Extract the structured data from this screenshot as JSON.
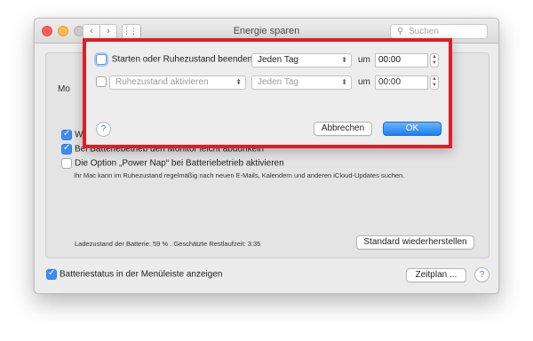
{
  "window": {
    "title": "Energie sparen",
    "search_placeholder": "Suchen",
    "nav_back": "‹",
    "nav_forward": "›",
    "grid": "⋮⋮⋮"
  },
  "main": {
    "partial_label": "Mo",
    "checkbox1_label": "We",
    "checkbox2_label": "Bei Batteriebetrieb den Monitor leicht abdunkeln",
    "checkbox3_label": "Die Option „Power Nap“ bei Batteriebetrieb aktivieren",
    "power_nap_description": "Ihr Mac kann im Ruhezustand regelmäßig nach neuen E-Mails, Kalendern und anderen iCloud-Updates suchen.",
    "battery_status": "Ladezustand der Batterie: 59 % . Geschätzte Restlaufzeit: 3:35",
    "restore_defaults_label": "Standard wiederherstellen",
    "menubar_battery_label": "Batteriestatus in der Menüleiste anzeigen",
    "schedule_label": "Zeitplan ...",
    "help_label": "?",
    "checkbox_states": {
      "checkbox1": true,
      "checkbox2": true,
      "checkbox3": false,
      "menubar_battery": true
    }
  },
  "sheet": {
    "row1": {
      "label": "Starten oder Ruhezustand beenden",
      "checked": false,
      "day": "Jeden Tag",
      "at_label": "um",
      "time": "00:00"
    },
    "row2": {
      "action": "Ruhezustand aktivieren",
      "checked": false,
      "day": "Jeden Tag",
      "at_label": "um",
      "time": "00:00"
    },
    "help_label": "?",
    "cancel_label": "Abbrechen",
    "ok_label": "OK",
    "highlight_color": "#e11d25"
  }
}
